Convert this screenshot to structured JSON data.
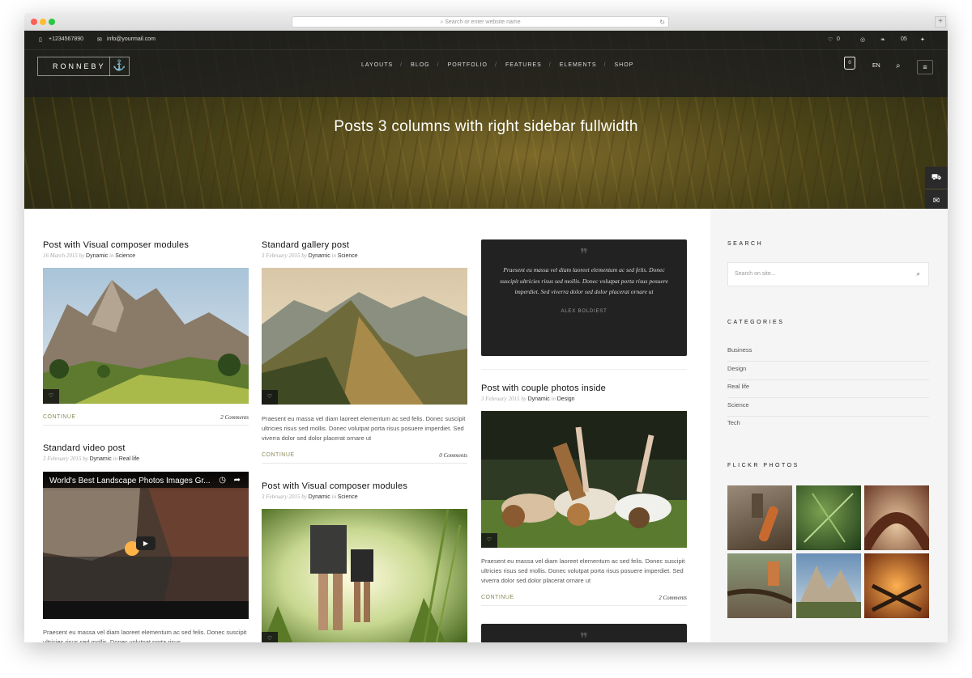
{
  "browser": {
    "url_placeholder": "Search or enter website name",
    "reload": "↻",
    "new_tab": "+"
  },
  "topbar": {
    "phone": "+1234567890",
    "email": "info@yourmail.com",
    "wishlist_count": "0",
    "right_icons": [
      "dribbble-icon",
      "evernote-icon",
      "500px-icon",
      "twitter-icon"
    ],
    "icon_glyphs": [
      "◎",
      "❧",
      "05",
      "✦"
    ]
  },
  "nav": {
    "logo": "RONNEBY",
    "anchor": "⚓",
    "menu": [
      "LAYOUTS",
      "BLOG",
      "PORTFOLIO",
      "FEATURES",
      "ELEMENTS",
      "SHOP"
    ],
    "cart_count": "0",
    "lang": "EN"
  },
  "hero": {
    "title": "Posts 3 columns with right sidebar fullwidth"
  },
  "posts": {
    "p1": {
      "title": "Post with Visual composer modules",
      "date": "16 March 2015",
      "by": "by",
      "author": "Dynamic",
      "in": "in",
      "category": "Science",
      "continue": "CONTINUE",
      "comments": "2  Comments"
    },
    "p2": {
      "title": "Standard video post",
      "date": "3 February 2015",
      "by": "by",
      "author": "Dynamic",
      "in": "in",
      "category": "Real life",
      "video_title": "World's Best Landscape Photos Images Gr...",
      "excerpt": "Praesent eu massa vel diam laoreet elementum ac sed felis. Donec suscipit ultricies risus sed mollis. Donec volutpat porta risus"
    },
    "p3": {
      "title": "Standard gallery post",
      "date": "3 February 2015",
      "by": "by",
      "author": "Dynamic",
      "in": "in",
      "category": "Science",
      "excerpt": "Praesent eu massa vel diam laoreet elementum ac sed felis. Donec suscipit ultricies risus sed mollis. Donec volutpat porta risus posuere imperdiet. Sed viverra dolor sed dolor placerat ornare ut",
      "continue": "CONTINUE",
      "comments": "0  Comments"
    },
    "p4": {
      "title": "Post with Visual composer modules",
      "date": "3 February 2015",
      "by": "by",
      "author": "Dynamic",
      "in": "in",
      "category": "Science"
    },
    "quote": {
      "mark": "❞",
      "text": "Praesent eu massa vel diam laoreet elementum ac sed felis. Donec suscipit ultricies risus sed mollis. Donec volutpat porta risus posuere imperdiet. Sed viverra dolor sed dolor placerat ornare ut",
      "author": "ALEX BOLDIEST"
    },
    "p5": {
      "title": "Post with couple photos inside",
      "date": "3 February 2015",
      "by": "by",
      "author": "Dynamic",
      "in": "in",
      "category": "Design",
      "excerpt": "Praesent eu massa vel diam laoreet elementum ac sed felis. Donec suscipit ultricies risus sed mollis. Donec volutpat porta risus posuere imperdiet. Sed viverra dolor sed dolor placerat ornare ut",
      "continue": "CONTINUE",
      "comments": "2  Comments"
    },
    "quote2": {
      "mark": "❞"
    }
  },
  "sidebar": {
    "search_heading": "SEARCH",
    "search_placeholder": "Search on site...",
    "categories_heading": "CATEGORIES",
    "categories": [
      "Business",
      "Design",
      "Real life",
      "Science",
      "Tech"
    ],
    "flickr_heading": "FLICKR PHOTOS"
  }
}
